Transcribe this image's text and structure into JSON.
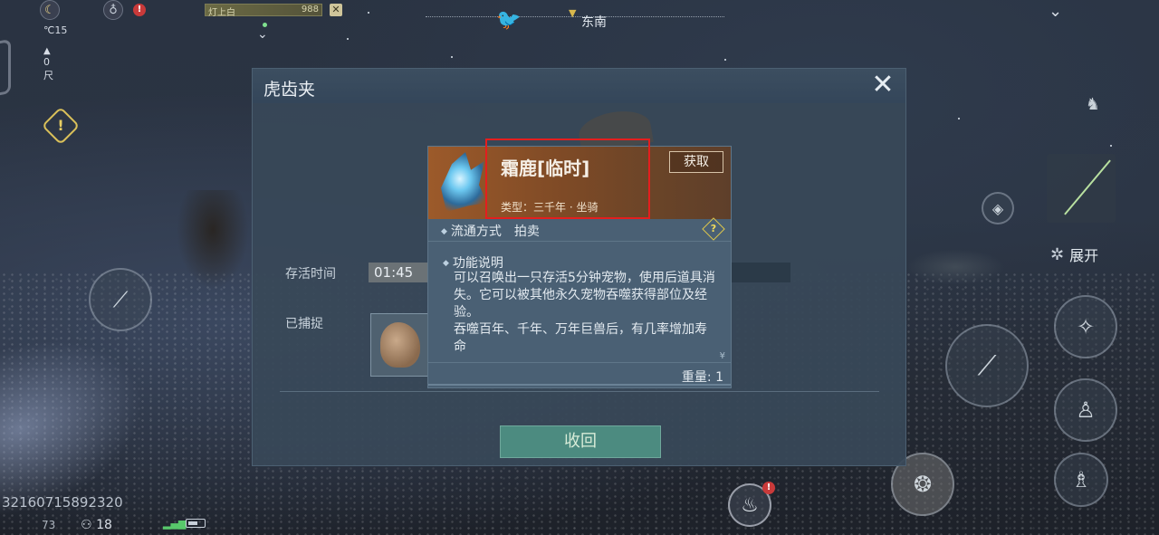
{
  "hud": {
    "temperature": "15",
    "temperature_unit": "℃",
    "altitude": "0尺",
    "target_name": "灯上白",
    "target_value": "988",
    "close_glyph": "✕",
    "compass_direction": "东南",
    "player_id": "32160715892320",
    "stat_a": "73",
    "stat_fps": "18",
    "expand_label": "展开"
  },
  "dialog": {
    "title": "虎齿夹",
    "close_glyph": "✕",
    "survival_label": "存活时间",
    "survival_value": "01:45",
    "captured_label": "已捕捉",
    "recall_button": "收回"
  },
  "tooltip": {
    "item_name": "霜鹿[临时]",
    "obtain_button": "获取",
    "item_type": "类型：三千年 · 坐骑",
    "circulation_label": "流通方式",
    "circulation_value": "拍卖",
    "help_glyph": "?",
    "desc_title": "功能说明",
    "desc_body": "可以召唤出一只存活5分钟宠物，使用后道具消失。它可以被其他永久宠物吞噬获得部位及经验。\n吞噬百年、千年、万年巨兽后，有几率增加寿命",
    "scroll_glyph": "¥",
    "weight": "重量: 1"
  },
  "colors": {
    "highlight": "#e41e1e",
    "recall_button_bg": "#4c8b80",
    "tooltip_header": "#9c5a2a",
    "dialog_bg": "#384858"
  },
  "icons": [
    "moon-icon",
    "thermometer-icon",
    "mountain-icon",
    "stomach-icon",
    "warning-icon",
    "compass-bird-icon",
    "chevron-down-icon",
    "close-icon",
    "frost-deer-icon",
    "horse-icon",
    "help-icon",
    "flute-icon",
    "dance-icon",
    "climb-icon",
    "food-bag-icon",
    "pet-icon",
    "map-icon"
  ]
}
